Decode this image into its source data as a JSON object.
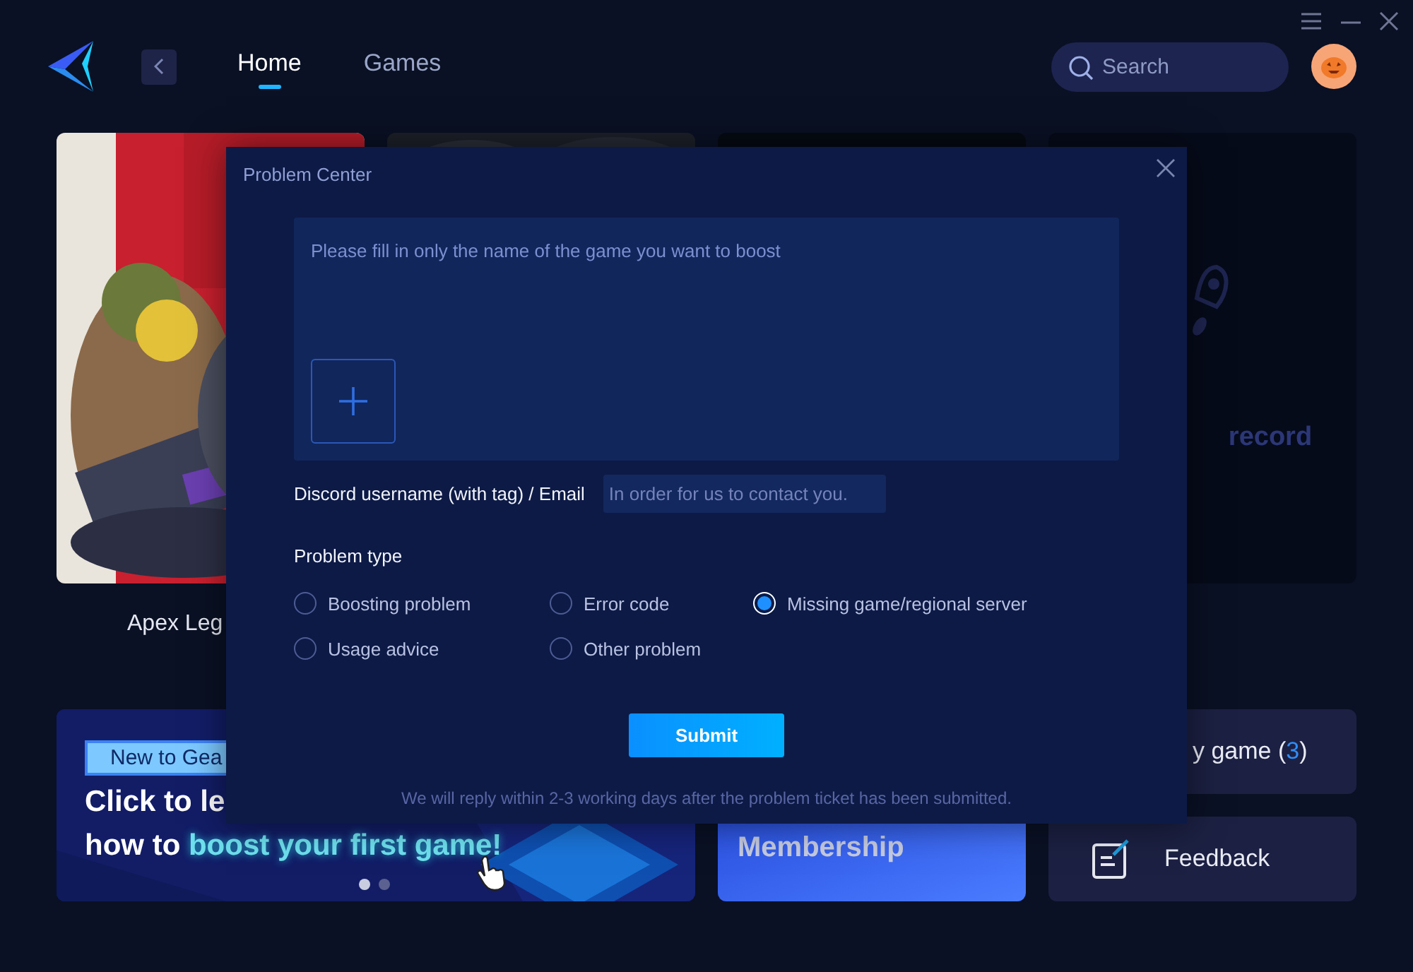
{
  "nav": {
    "tabs": [
      {
        "label": "Home",
        "selected": true
      },
      {
        "label": "Games",
        "selected": false
      }
    ],
    "search": {
      "placeholder": "Search"
    }
  },
  "games": [
    {
      "kind": "picture",
      "title": "Apex Leg"
    },
    {
      "kind": "picture"
    },
    {
      "kind": "blank"
    },
    {
      "kind": "rocket",
      "title": "record"
    }
  ],
  "banner": {
    "tag": "New to Gea",
    "line1": "Click to le",
    "line2": "how to ",
    "line2_highlight": "boost your first game!",
    "dots": [
      {
        "selected": true
      },
      {
        "selected": false
      }
    ]
  },
  "membership": {
    "title": "Membership"
  },
  "my_game": {
    "label": "y game (",
    "count": "3",
    "close": ")"
  },
  "feedback": {
    "label": "Feedback"
  },
  "dialog": {
    "title": "Problem Center",
    "description": {
      "placeholder": "Please fill in only the name of the game you want to boost"
    },
    "contact": {
      "label": "Discord username (with tag) / Email",
      "placeholder": "In order for us to contact you."
    },
    "problem_type": {
      "label": "Problem type",
      "options": [
        {
          "label": "Boosting problem",
          "selected": false
        },
        {
          "label": "Error code",
          "selected": false
        },
        {
          "label": "Missing game/regional server",
          "selected": true
        },
        {
          "label": "Usage advice",
          "selected": false
        },
        {
          "label": "Other problem",
          "selected": false
        }
      ]
    },
    "submit": "Submit",
    "note": "We will reply within 2-3 working days after the problem ticket has been submitted."
  }
}
